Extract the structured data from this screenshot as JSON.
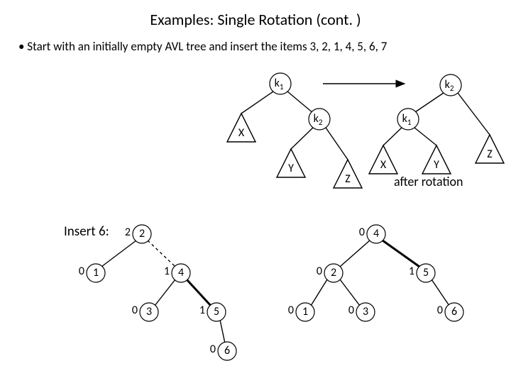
{
  "title": "Examples: Single Rotation (cont. )",
  "bullet": "•   Start with an initially empty AVL tree and insert the items 3, 2, 1, 4, 5, 6, 7",
  "insert_label": "Insert 6:",
  "after_rotation": "after rotation",
  "labels": {
    "k1": "k",
    "k1_sub": "1",
    "k2": "k",
    "k2_sub": "2",
    "X": "X",
    "Y": "Y",
    "Z": "Z"
  },
  "left_tree": {
    "root": {
      "h": "2",
      "v": "2"
    },
    "l": {
      "h": "0",
      "v": "1"
    },
    "r": {
      "h": "1",
      "v": "4"
    },
    "rl": {
      "h": "0",
      "v": "3"
    },
    "rr": {
      "h": "1",
      "v": "5"
    },
    "rrr": {
      "h": "0",
      "v": "6"
    }
  },
  "right_tree": {
    "root": {
      "h": "0",
      "v": "4"
    },
    "l": {
      "h": "0",
      "v": "2"
    },
    "r": {
      "h": "1",
      "v": "5"
    },
    "ll": {
      "h": "0",
      "v": "1"
    },
    "lr": {
      "h": "0",
      "v": "3"
    },
    "rr": {
      "h": "0",
      "v": "6"
    }
  },
  "chart_data": {
    "type": "table",
    "description": "AVL single-rotation example: abstract rotation schematic then concrete insert-6 step",
    "abstract_before": {
      "root": "k1",
      "children": {
        "left": "X (subtree)",
        "right": "k2"
      },
      "k2_children": {
        "left": "Y (subtree)",
        "right": "Z (subtree)"
      }
    },
    "abstract_after": {
      "root": "k2",
      "children": {
        "left": "k1",
        "right": "Z (subtree)"
      },
      "k1_children": {
        "left": "X (subtree)",
        "right": "Y (subtree)"
      }
    },
    "concrete_before": [
      {
        "node": 2,
        "parent": null,
        "height_label": 2
      },
      {
        "node": 1,
        "parent": 2,
        "height_label": 0
      },
      {
        "node": 4,
        "parent": 2,
        "height_label": 1
      },
      {
        "node": 3,
        "parent": 4,
        "height_label": 0
      },
      {
        "node": 5,
        "parent": 4,
        "height_label": 1
      },
      {
        "node": 6,
        "parent": 5,
        "height_label": 0
      }
    ],
    "concrete_after": [
      {
        "node": 4,
        "parent": null,
        "height_label": 0
      },
      {
        "node": 2,
        "parent": 4,
        "height_label": 0
      },
      {
        "node": 5,
        "parent": 4,
        "height_label": 1
      },
      {
        "node": 1,
        "parent": 2,
        "height_label": 0
      },
      {
        "node": 3,
        "parent": 2,
        "height_label": 0
      },
      {
        "node": 6,
        "parent": 5,
        "height_label": 0
      }
    ]
  }
}
